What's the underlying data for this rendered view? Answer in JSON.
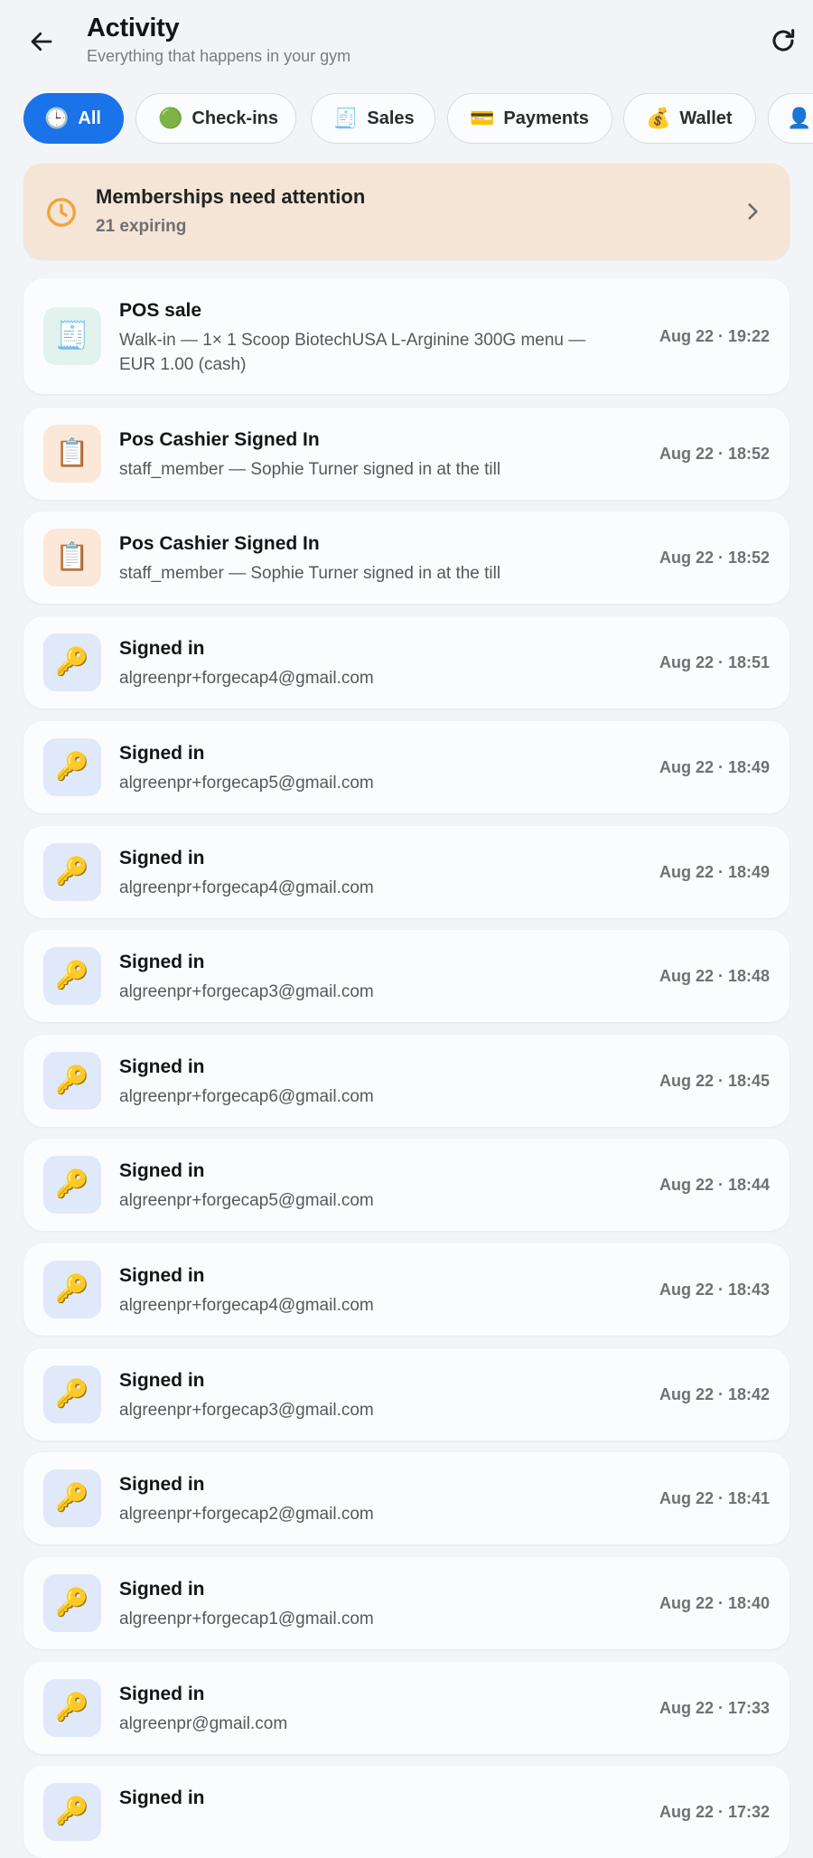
{
  "header": {
    "title": "Activity",
    "subtitle": "Everything that happens in your gym",
    "back_icon": "arrow-left-icon",
    "refresh_icon": "refresh-icon"
  },
  "filters": [
    {
      "label": "All",
      "icon": "🕒",
      "active": true
    },
    {
      "label": "Check-ins",
      "icon": "🟢",
      "active": false
    },
    {
      "label": "Sales",
      "icon": "🧾",
      "active": false
    },
    {
      "label": "Payments",
      "icon": "💳",
      "active": false
    },
    {
      "label": "Wallet",
      "icon": "💰",
      "active": false
    },
    {
      "label": "",
      "icon": "👤",
      "active": false
    }
  ],
  "alert": {
    "title": "Memberships need attention",
    "subtitle": "21 expiring",
    "icon": "clock-icon"
  },
  "colors": {
    "accent": "#1a73e8",
    "alert_bg": "#f4e5d6",
    "alert_icon": "#f2a33a",
    "sale_icon_bg": "#e2f2ec",
    "cashier_icon_bg": "#fbe8d8",
    "signin_icon_bg": "#dfe9fa"
  },
  "activities": [
    {
      "type": "sale",
      "icon": "🧾",
      "title": "POS sale",
      "desc_lines": [
        "Walk-in — 1× 1 Scoop BiotechUSA L-Arginine 300G menu —",
        "EUR 1.00 (cash)"
      ],
      "time": "Aug 22 · 19:22"
    },
    {
      "type": "cashier",
      "icon": "📋",
      "title": "Pos Cashier Signed In",
      "desc_lines": [
        "staff_member — Sophie Turner signed in at the till"
      ],
      "time": "Aug 22 · 18:52"
    },
    {
      "type": "cashier",
      "icon": "📋",
      "title": "Pos Cashier Signed In",
      "desc_lines": [
        "staff_member — Sophie Turner signed in at the till"
      ],
      "time": "Aug 22 · 18:52"
    },
    {
      "type": "signin",
      "icon": "🔑",
      "title": "Signed in",
      "desc_lines": [
        "algreenpr+forgecap4@gmail.com"
      ],
      "time": "Aug 22 · 18:51"
    },
    {
      "type": "signin",
      "icon": "🔑",
      "title": "Signed in",
      "desc_lines": [
        "algreenpr+forgecap5@gmail.com"
      ],
      "time": "Aug 22 · 18:49"
    },
    {
      "type": "signin",
      "icon": "🔑",
      "title": "Signed in",
      "desc_lines": [
        "algreenpr+forgecap4@gmail.com"
      ],
      "time": "Aug 22 · 18:49"
    },
    {
      "type": "signin",
      "icon": "🔑",
      "title": "Signed in",
      "desc_lines": [
        "algreenpr+forgecap3@gmail.com"
      ],
      "time": "Aug 22 · 18:48"
    },
    {
      "type": "signin",
      "icon": "🔑",
      "title": "Signed in",
      "desc_lines": [
        "algreenpr+forgecap6@gmail.com"
      ],
      "time": "Aug 22 · 18:45"
    },
    {
      "type": "signin",
      "icon": "🔑",
      "title": "Signed in",
      "desc_lines": [
        "algreenpr+forgecap5@gmail.com"
      ],
      "time": "Aug 22 · 18:44"
    },
    {
      "type": "signin",
      "icon": "🔑",
      "title": "Signed in",
      "desc_lines": [
        "algreenpr+forgecap4@gmail.com"
      ],
      "time": "Aug 22 · 18:43"
    },
    {
      "type": "signin",
      "icon": "🔑",
      "title": "Signed in",
      "desc_lines": [
        "algreenpr+forgecap3@gmail.com"
      ],
      "time": "Aug 22 · 18:42"
    },
    {
      "type": "signin",
      "icon": "🔑",
      "title": "Signed in",
      "desc_lines": [
        "algreenpr+forgecap2@gmail.com"
      ],
      "time": "Aug 22 · 18:41"
    },
    {
      "type": "signin",
      "icon": "🔑",
      "title": "Signed in",
      "desc_lines": [
        "algreenpr+forgecap1@gmail.com"
      ],
      "time": "Aug 22 · 18:40"
    },
    {
      "type": "signin",
      "icon": "🔑",
      "title": "Signed in",
      "desc_lines": [
        "algreenpr@gmail.com"
      ],
      "time": "Aug 22 · 17:33"
    },
    {
      "type": "signin",
      "icon": "🔑",
      "title": "Signed in",
      "desc_lines": [
        ""
      ],
      "time": "Aug 22 · 17:32"
    }
  ]
}
